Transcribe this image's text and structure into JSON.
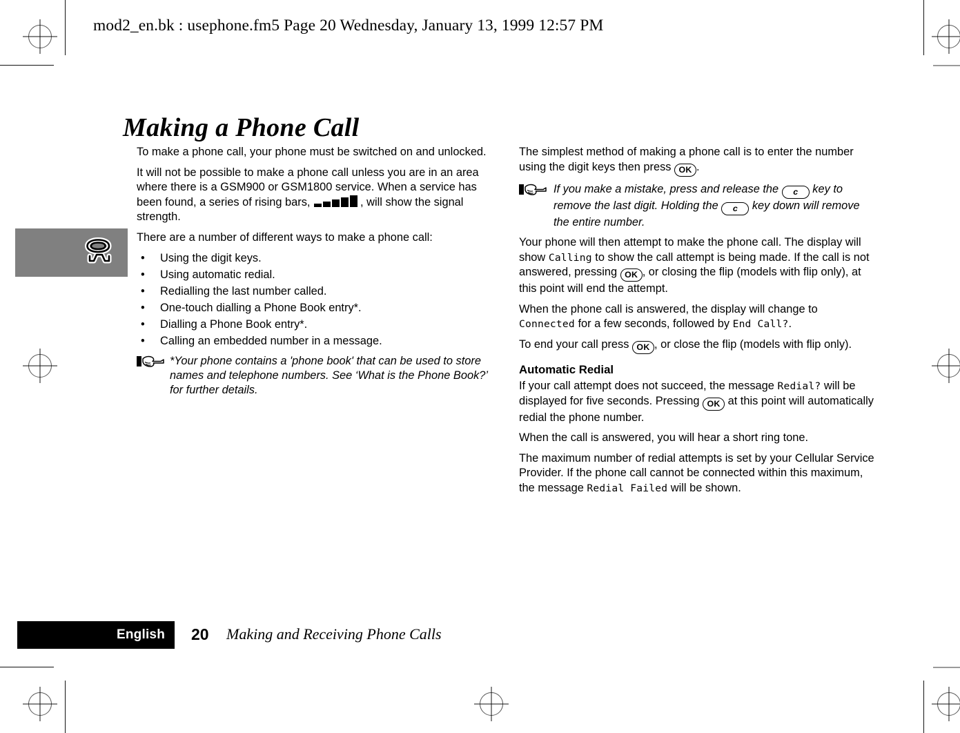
{
  "print_header": {
    "text": "mod2_en.bk : usephone.fm5  Page 20  Wednesday, January 13, 1999  12:57 PM"
  },
  "chapter": {
    "title": "Making a Phone Call"
  },
  "side_tab": {
    "icon": "telephone-icon",
    "background_color": "#808080"
  },
  "left_column": {
    "para_1": "To make a phone call, your phone must be switched on and unlocked.",
    "para_2_a": "It will not be possible to make a phone call unless you are in an area where there is a GSM900 or GSM1800 service. When a service has been found, a series of rising bars, ",
    "para_2_icon": "signal-strength-bars-icon",
    "para_2_b": ", will show the signal strength.",
    "para_3": "There are a number of different ways to make a phone call:",
    "bullet_char": "•",
    "bullets": [
      "Using the digit keys.",
      "Using automatic redial.",
      "Redialling the last number called.",
      "One-touch dialling a Phone Book entry*.",
      "Dialling a Phone Book entry*.",
      "Calling an embedded number in a message."
    ],
    "note": {
      "icon": "pointing-hand-icon",
      "text": "*Your phone contains a 'phone book' that can be used to store names and telephone numbers. See ‘What is the Phone Book?’ for further details."
    }
  },
  "right_column": {
    "para_1_a": "The simplest method of making a phone call is to enter the number using the digit keys then press ",
    "para_1_key": "OK",
    "para_1_b": ".",
    "note": {
      "icon": "pointing-hand-icon",
      "text_a": "If you make a mistake, press and release the ",
      "key_1": "c",
      "text_b": " key to remove the last digit. Holding the ",
      "key_2": "c",
      "text_c": " key down will remove the entire number."
    },
    "para_2_a": "Your phone will then attempt to make the phone call. The display will show ",
    "para_2_lcd": "Calling",
    "para_2_b": " to show the call attempt is being made. If the call is not answered, pressing ",
    "para_2_key": "OK",
    "para_2_c": ", or closing the flip (models with flip only), at this point will end the attempt.",
    "para_3_a": "When the phone call is answered, the display will change to ",
    "para_3_lcd_1": "Connected",
    "para_3_b": " for a few seconds, followed by ",
    "para_3_lcd_2": "End Call?",
    "para_3_c": ".",
    "para_4_a": "To end your call press ",
    "para_4_key": "OK",
    "para_4_b": ", or close the flip (models with flip only).",
    "subheading": "Automatic Redial",
    "para_5_a": "If your call attempt does not succeed, the message ",
    "para_5_lcd": "Redial?",
    "para_5_b": " will be displayed for five seconds. Pressing ",
    "para_5_key": "OK",
    "para_5_c": " at this point will automatically redial the phone number.",
    "para_6": "When the call is answered, you will hear a short ring tone.",
    "para_7_a": "The maximum number of redial attempts is set by your Cellular Service Provider. If the phone call cannot be connected within this maximum, the message ",
    "para_7_lcd": "Redial Failed",
    "para_7_b": " will be shown."
  },
  "footer": {
    "language": "English",
    "page_number": "20",
    "section_title": "Making and Receiving Phone Calls",
    "bar_color": "#000000"
  }
}
